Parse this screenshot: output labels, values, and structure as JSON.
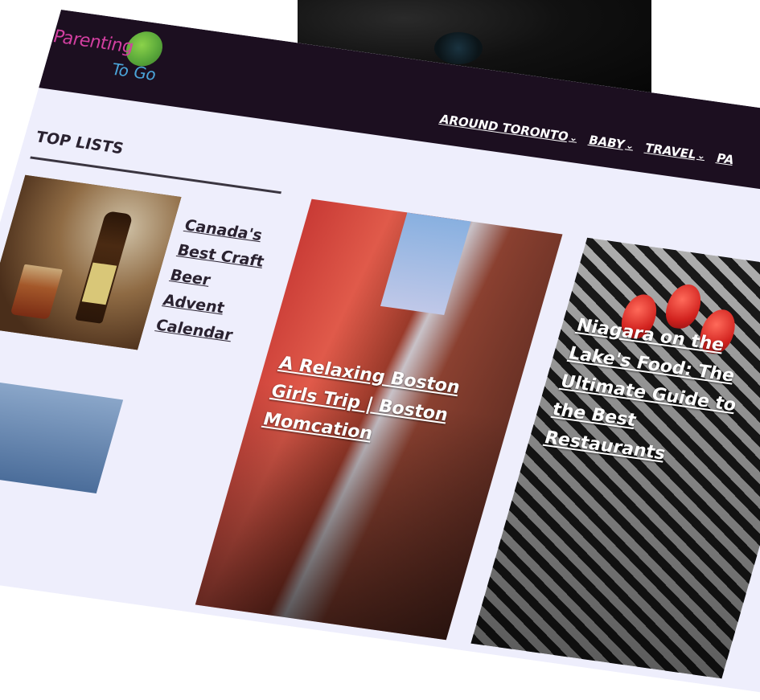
{
  "site": {
    "logo_line1": "Parenting",
    "logo_line2": "To Go"
  },
  "nav": {
    "items": [
      {
        "label": "AROUND TORONTO"
      },
      {
        "label": "BABY"
      },
      {
        "label": "TRAVEL"
      },
      {
        "label": "PA"
      }
    ]
  },
  "sidebar": {
    "title": "TOP LISTS",
    "items": [
      {
        "title": "Canada's Best Craft Beer Advent Calendar"
      }
    ]
  },
  "cards": [
    {
      "title": "A Relaxing Boston Girls Trip | Boston Momcation"
    },
    {
      "title": "Niagara on the Lake's Food: The Ultimate Guide to the Best Restaurants"
    }
  ],
  "colors": {
    "header_bg": "#1c0f20",
    "page_bg": "#eeeefc",
    "logo_pink": "#d23fa0",
    "logo_blue": "#4aa3d8"
  }
}
